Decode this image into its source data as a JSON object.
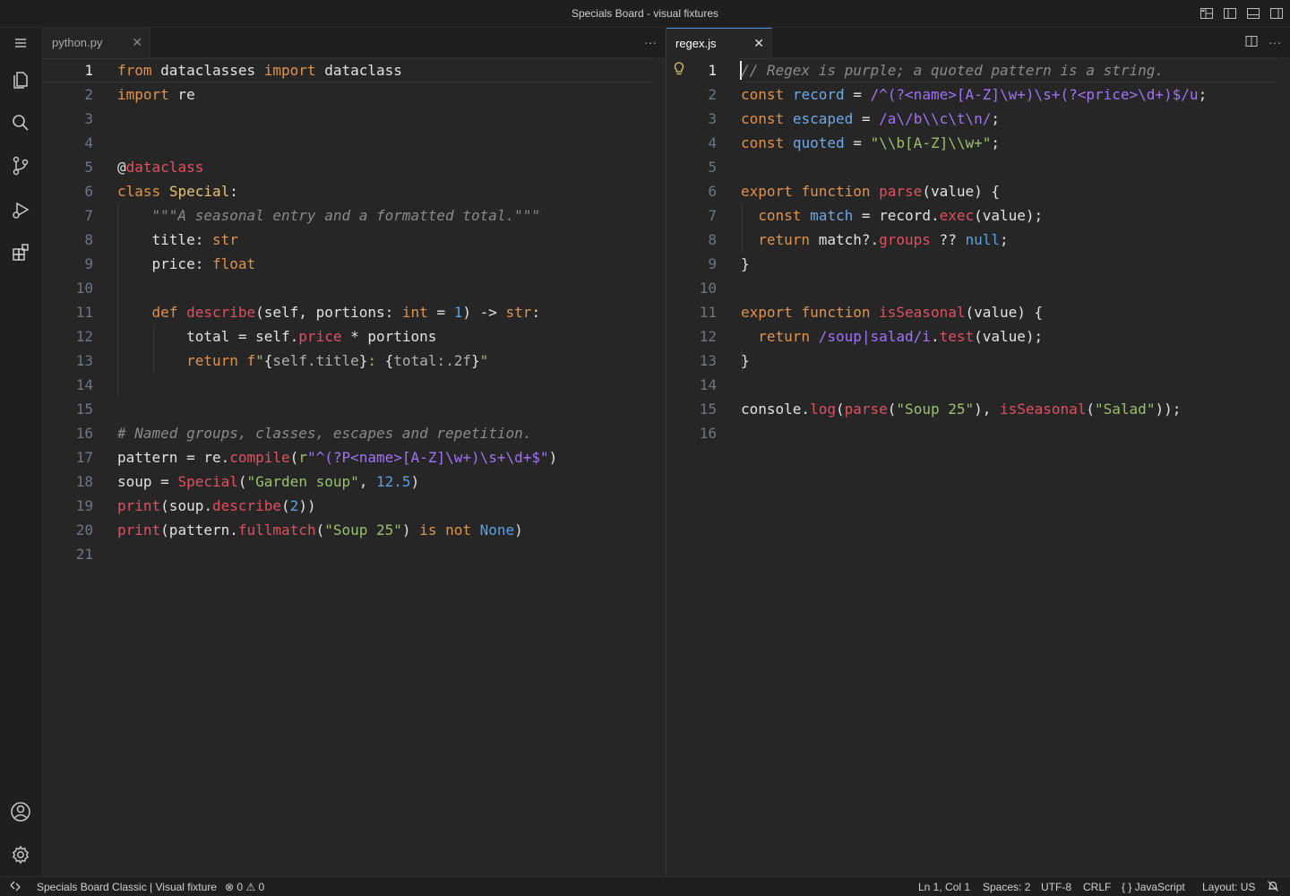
{
  "window": {
    "title": "Specials Board - visual fixtures"
  },
  "titlebar_icons": [
    "layout-customize-icon",
    "toggle-sidebar-icon",
    "toggle-panel-icon",
    "toggle-secondary-sidebar-icon"
  ],
  "activity_bar": {
    "top": [
      "menu-icon",
      "explorer-icon",
      "search-icon",
      "source-control-icon",
      "run-debug-icon",
      "extensions-icon"
    ],
    "bottom": [
      "accounts-icon",
      "settings-gear-icon"
    ]
  },
  "left_pane": {
    "tab_label": "python.py",
    "active_line": 1,
    "lines": [
      "from dataclasses import dataclass",
      "import re",
      "",
      "",
      "@dataclass",
      "class Special:",
      "    \"\"\"A seasonal entry and a formatted total.\"\"\"",
      "    title: str",
      "    price: float",
      "",
      "    def describe(self, portions: int = 1) -> str:",
      "        total = self.price * portions",
      "        return f\"{self.title}: {total:.2f}\"",
      "",
      "",
      "# Named groups, classes, escapes and repetition.",
      "pattern = re.compile(r\"^(?P<name>[A-Z]\\w+)\\s+\\d+$\")",
      "soup = Special(\"Garden soup\", 12.5)",
      "print(soup.describe(2))",
      "print(pattern.fullmatch(\"Soup 25\") is not None)",
      ""
    ]
  },
  "right_pane": {
    "tab_label": "regex.js",
    "active_line": 1,
    "lines": [
      "// Regex is purple; a quoted pattern is a string.",
      "const record = /^(?<name>[A-Z]\\w+)\\s+(?<price>\\d+)$/u;",
      "const escaped = /a\\/b\\\\c\\t\\n/;",
      "const quoted = \"\\\\b[A-Z]\\\\w+\";",
      "",
      "export function parse(value) {",
      "  const match = record.exec(value);",
      "  return match?.groups ?? null;",
      "}",
      "",
      "export function isSeasonal(value) {",
      "  return /soup|salad/i.test(value);",
      "}",
      "",
      "console.log(parse(\"Soup 25\"), isSeasonal(\"Salad\"));",
      ""
    ]
  },
  "status_bar": {
    "profile": "Specials Board Classic | Visual fixture",
    "errors": "0",
    "warnings": "0",
    "cursor": "Ln 1, Col 1",
    "spaces": "Spaces: 2",
    "encoding": "UTF-8",
    "eol": "CRLF",
    "language": "JavaScript",
    "layout": "Layout: US"
  },
  "colors": {
    "keyword": "#e0924b",
    "function": "#e0505f",
    "class": "#e6c376",
    "string": "#97c26a",
    "number": "#5aa0e6",
    "regex": "#a371f7",
    "comment": "#8a8a8a"
  }
}
